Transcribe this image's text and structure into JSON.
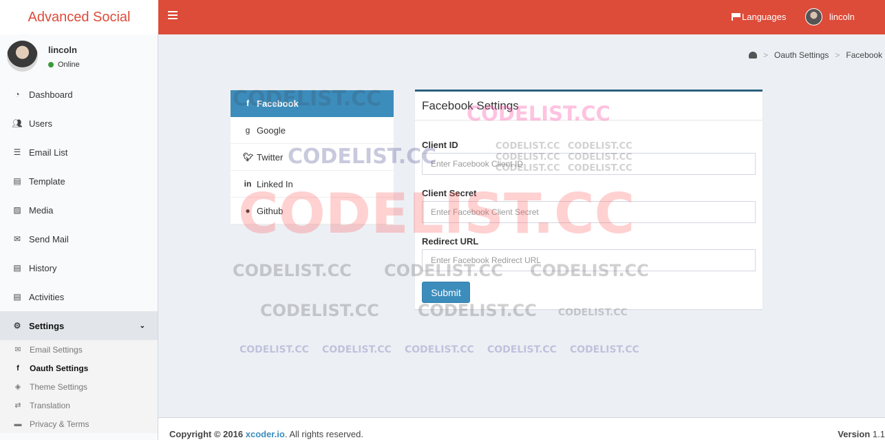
{
  "brand": "Advanced Social",
  "colors": {
    "header": "#dd4b39",
    "accent": "#3c8dbc",
    "card_border": "#2c5f7c"
  },
  "topbar": {
    "languages_label": "Languages",
    "user_name": "lincoln"
  },
  "user_panel": {
    "name": "lincoln",
    "status": "Online"
  },
  "sidebar": {
    "items": [
      {
        "label": "Dashboard",
        "icon": "dashboard-icon"
      },
      {
        "label": "Users",
        "icon": "users-icon"
      },
      {
        "label": "Email List",
        "icon": "list-icon"
      },
      {
        "label": "Template",
        "icon": "template-icon"
      },
      {
        "label": "Media",
        "icon": "image-icon"
      },
      {
        "label": "Send Mail",
        "icon": "envelope-icon"
      },
      {
        "label": "History",
        "icon": "history-icon"
      },
      {
        "label": "Activities",
        "icon": "activities-icon"
      }
    ],
    "settings": {
      "label": "Settings",
      "icon": "gears-icon",
      "sub": [
        {
          "label": "Email Settings",
          "icon": "envelope-outline-icon"
        },
        {
          "label": "Oauth Settings",
          "icon": "facebook-icon"
        },
        {
          "label": "Theme Settings",
          "icon": "codepen-icon"
        },
        {
          "label": "Translation",
          "icon": "translate-icon"
        },
        {
          "label": "Privacy & Terms",
          "icon": "archive-icon"
        }
      ]
    }
  },
  "breadcrumb": {
    "items": [
      "Oauth Settings",
      "Facebook"
    ]
  },
  "oauth": {
    "providers": [
      {
        "label": "Facebook",
        "icon": "facebook-icon",
        "active": true
      },
      {
        "label": "Google",
        "icon": "google-icon"
      },
      {
        "label": "Twitter",
        "icon": "twitter-icon"
      },
      {
        "label": "Linked In",
        "icon": "linkedin-icon"
      },
      {
        "label": "Github",
        "icon": "github-icon"
      }
    ]
  },
  "form": {
    "title": "Facebook Settings",
    "client_id_label": "Client ID",
    "client_id_placeholder": "Enter Facebook Client ID",
    "client_secret_label": "Client Secret",
    "client_secret_placeholder": "Enter Facebook Client Secret",
    "redirect_label": "Redirect URL",
    "redirect_placeholder": "Enter Facebook Redirect URL",
    "submit_label": "Submit"
  },
  "watermark": "CODELIST.CC",
  "footer": {
    "copyright": "Copyright © 2016",
    "link_text": "xcoder.io",
    "rights": ". All rights reserved.",
    "version_label": "Version",
    "version_value": "1.1"
  }
}
